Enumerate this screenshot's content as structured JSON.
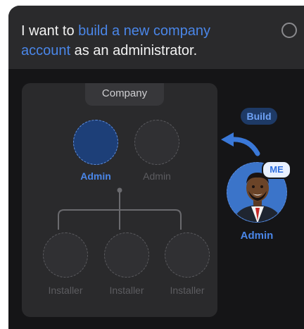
{
  "prompt": {
    "text_before": "I want to ",
    "highlight": "build a new company account",
    "text_after": " as an administrator."
  },
  "org_chart": {
    "company_label": "Company",
    "admins": [
      {
        "label": "Admin",
        "state": "selected"
      },
      {
        "label": "Admin",
        "state": "empty"
      }
    ],
    "installers": [
      {
        "label": "Installer"
      },
      {
        "label": "Installer"
      },
      {
        "label": "Installer"
      }
    ]
  },
  "user": {
    "action_badge": "Build",
    "me_badge": "ME",
    "role_label": "Admin",
    "avatar_icon": "man-portrait-avatar"
  },
  "colors": {
    "accent_blue": "#4a86e8",
    "card_background": "#151517",
    "header_background": "#2a2a2c",
    "panel_background": "#2a2a2c"
  }
}
